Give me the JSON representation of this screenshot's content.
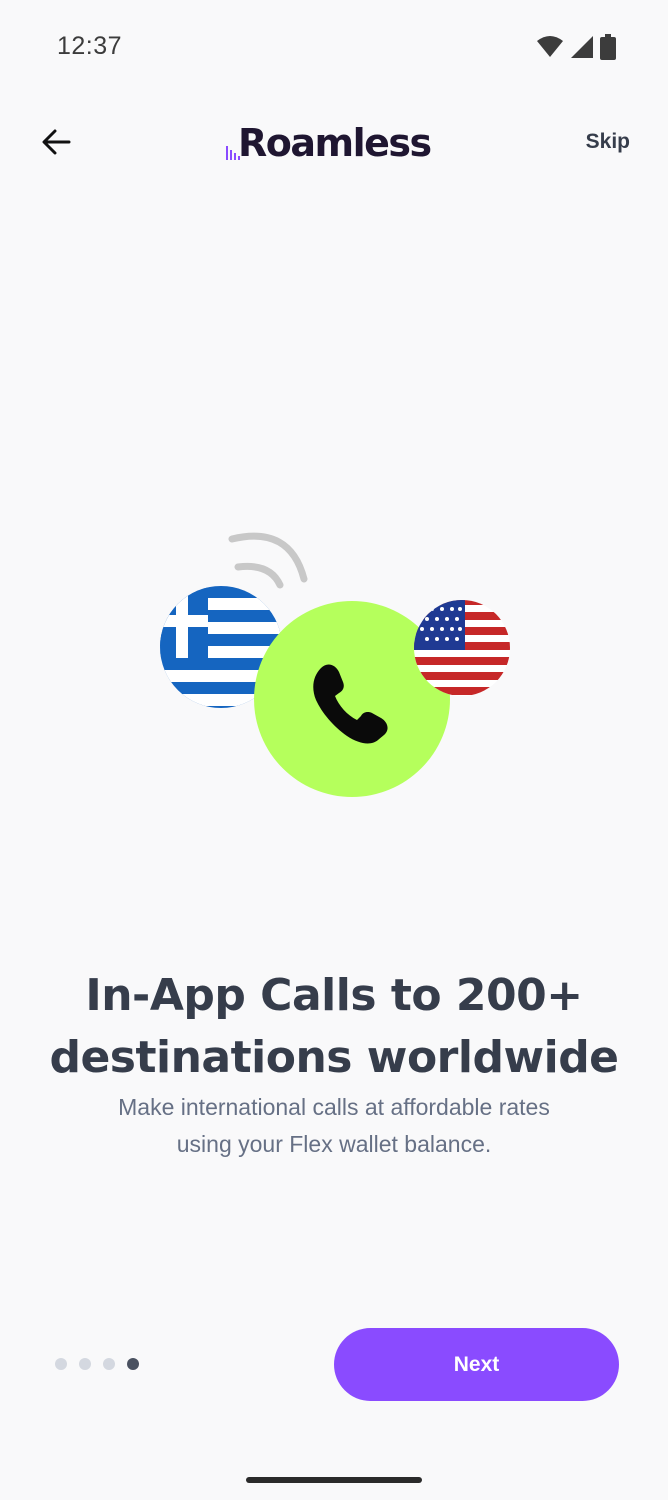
{
  "status_bar": {
    "time": "12:37",
    "icons": [
      "wifi-icon",
      "signal-icon",
      "battery-icon"
    ]
  },
  "header": {
    "back_icon": "arrow-left-icon",
    "logo_text": "Roamless",
    "skip_label": "Skip"
  },
  "illustration": {
    "icons": [
      "greece-flag-icon",
      "usa-flag-icon",
      "phone-icon",
      "signal-waves-icon"
    ],
    "call_circle_color": "#b5ff5c"
  },
  "content": {
    "title_line1": "In-App Calls to 200+",
    "title_line2": "destinations worldwide",
    "subtitle_line1": "Make international calls at affordable rates",
    "subtitle_line2": "using your Flex wallet balance."
  },
  "pagination": {
    "total": 4,
    "active_index": 3
  },
  "footer": {
    "next_label": "Next",
    "accent_color": "#8a4bff"
  }
}
